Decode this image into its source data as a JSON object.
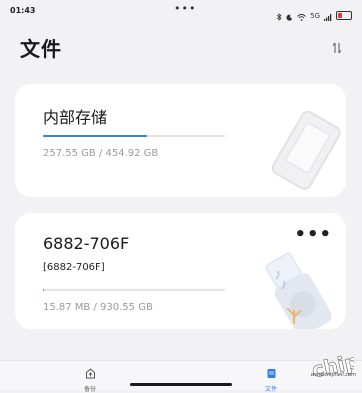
{
  "status_bar": {
    "time": "01:43",
    "dots": "•••",
    "network": "5G"
  },
  "header": {
    "title": "文件"
  },
  "storage_cards": [
    {
      "title": "内部存储",
      "subtitle": "",
      "size_text": "257.55 GB / 454.92 GB",
      "used_fraction": 0.57,
      "icon": "sd-card-icon"
    },
    {
      "title": "6882-706F",
      "subtitle": "[6882-706F]",
      "size_text": "15.87 MB / 930.55 GB",
      "used_fraction": 0.0,
      "icon": "usb-drive-icon",
      "menu": "•••"
    }
  ],
  "bottom_nav": [
    {
      "label": "备份",
      "icon": "backup-icon",
      "active": false
    },
    {
      "label": "文件",
      "icon": "files-icon",
      "active": true
    }
  ],
  "watermark": {
    "url": "www.chiphell.com"
  },
  "colors": {
    "accent": "#2f7ff2",
    "background": "#f2f2f4",
    "card": "#ffffff"
  }
}
